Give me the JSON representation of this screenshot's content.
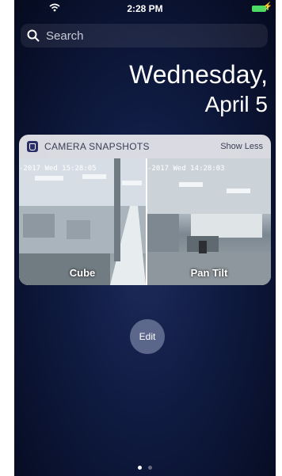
{
  "status_bar": {
    "time": "2:28 PM"
  },
  "search": {
    "placeholder": "Search"
  },
  "date": {
    "day": "Wednesday,",
    "date": "April 5"
  },
  "widget": {
    "title": "CAMERA SNAPSHOTS",
    "toggle_label": "Show Less",
    "cameras": [
      {
        "timestamp": "-2017 Wed 15:28:05",
        "name": "Cube"
      },
      {
        "timestamp": "-2017 Wed 14:28:03",
        "name": "Pan Tilt"
      }
    ]
  },
  "edit_label": "Edit",
  "pages": {
    "current": 1,
    "total": 2
  }
}
